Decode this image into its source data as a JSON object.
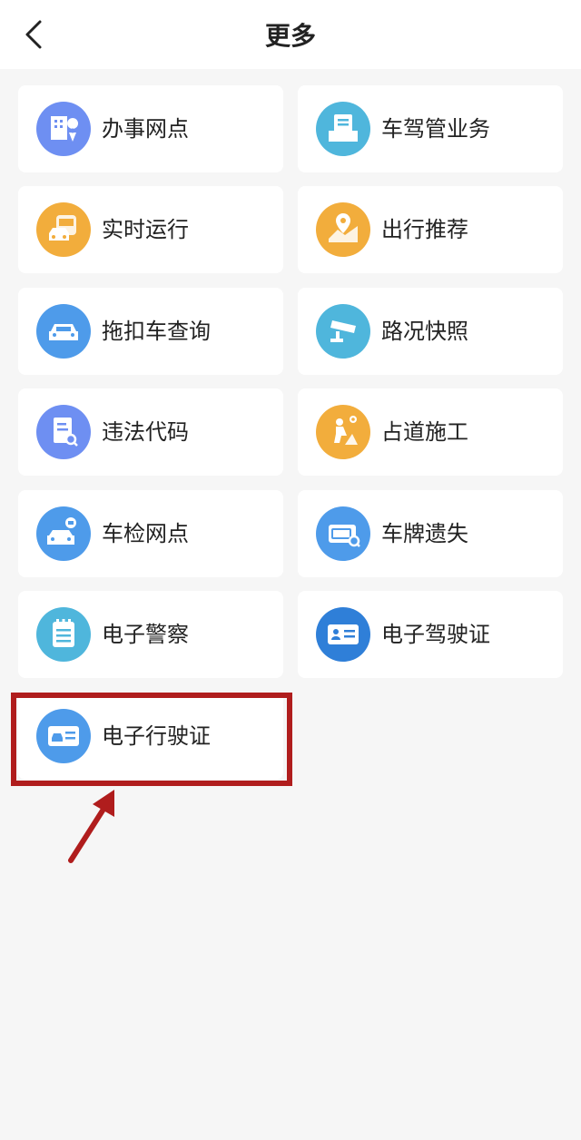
{
  "header": {
    "title": "更多"
  },
  "items": [
    {
      "label": "办事网点",
      "icon": "office-location-icon",
      "color": "#6e8ff2"
    },
    {
      "label": "车驾管业务",
      "icon": "document-tray-icon",
      "color": "#4fb6dc"
    },
    {
      "label": "实时运行",
      "icon": "bus-car-icon",
      "color": "#f2ad3c"
    },
    {
      "label": "出行推荐",
      "icon": "map-pin-icon",
      "color": "#f2ad3c"
    },
    {
      "label": "拖扣车查询",
      "icon": "car-icon",
      "color": "#4e9bea"
    },
    {
      "label": "路况快照",
      "icon": "camera-icon",
      "color": "#4fb6dc"
    },
    {
      "label": "违法代码",
      "icon": "document-search-icon",
      "color": "#6e8ff2"
    },
    {
      "label": "占道施工",
      "icon": "construction-worker-icon",
      "color": "#f2ad3c"
    },
    {
      "label": "车检网点",
      "icon": "car-inspection-icon",
      "color": "#4e9bea"
    },
    {
      "label": "车牌遗失",
      "icon": "license-plate-search-icon",
      "color": "#4e9bea"
    },
    {
      "label": "电子警察",
      "icon": "notepad-icon",
      "color": "#4fb6dc"
    },
    {
      "label": "电子驾驶证",
      "icon": "id-card-icon",
      "color": "#2f7fd8"
    },
    {
      "label": "电子行驶证",
      "icon": "vehicle-card-icon",
      "color": "#4e9bea"
    }
  ],
  "colors": {
    "highlight": "#b01d1d",
    "background": "#f6f6f6"
  }
}
